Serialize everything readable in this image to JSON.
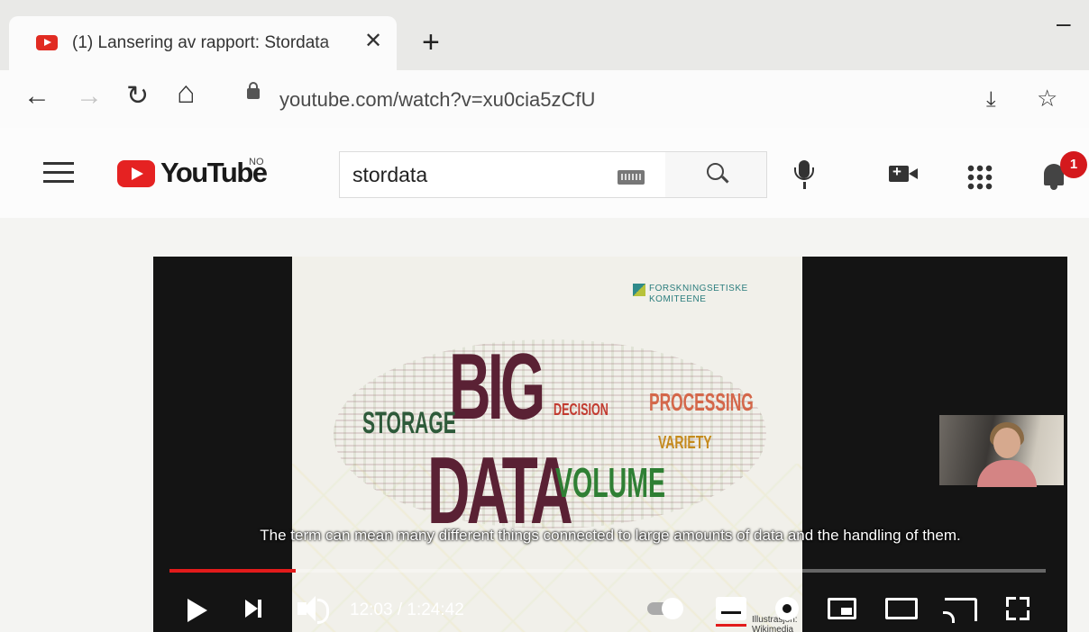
{
  "browser": {
    "tab_title": "(1) Lansering av rapport: Stordata",
    "tab_close": "✕",
    "new_tab": "+",
    "window_minimize": "–",
    "nav": {
      "back": "←",
      "forward": "→",
      "reload": "↻",
      "home": "⌂"
    },
    "url": "youtube.com/watch?v=xu0cia5zCfU",
    "toolbar_icons": {
      "install": "⤓",
      "bookmark": "☆"
    }
  },
  "youtube": {
    "logo_text": "YouTube",
    "country_code": "NO",
    "search_value": "stordata",
    "notification_count": "1"
  },
  "video": {
    "slide": {
      "org_name_line1": "FORSKNINGSETISKE",
      "org_name_line2": "KOMITEENE",
      "word_big": "BIG",
      "word_data": "DATA",
      "word_storage": "STORAGE",
      "word_processing": "PROCESSING",
      "word_volume": "VOLUME",
      "word_decision": "DECISION",
      "word_variety": "VARIETY",
      "credit": "Illustrasjon: Wikimedia Commons"
    },
    "subtitle": "The term can mean many different things connected to large amounts of data and the handling of them.",
    "time": "12:03 / 1:24:42",
    "progress_fraction": 0.144
  },
  "colors": {
    "youtube_red": "#e52222",
    "progress_red": "#e21b1b",
    "slide_word": "#5a2134"
  }
}
